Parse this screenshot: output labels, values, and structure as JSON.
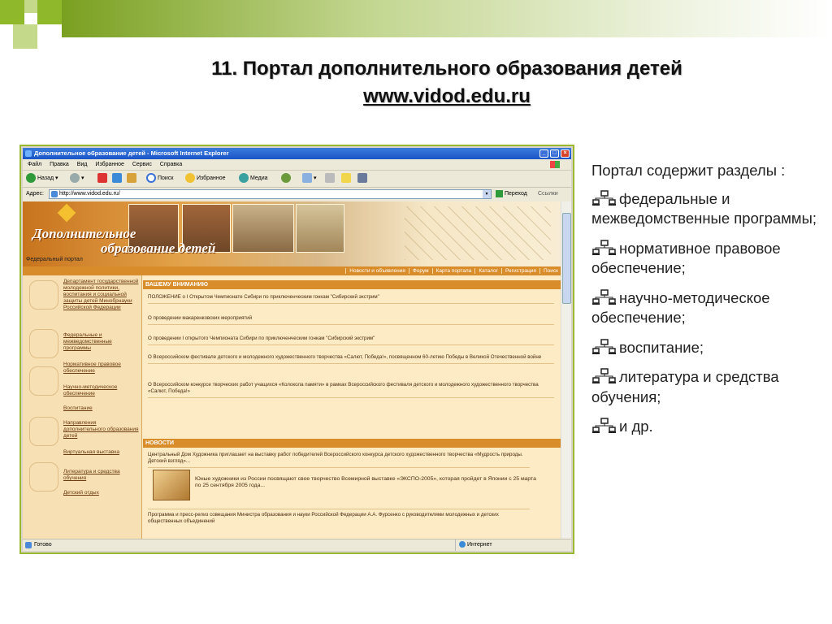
{
  "slide": {
    "title_line1": "11. Портал дополнительного образования детей",
    "title_line2": "www.vidod.edu.ru"
  },
  "browser": {
    "title": "Дополнительное образование детей - Microsoft Internet Explorer",
    "menu": [
      "Файл",
      "Правка",
      "Вид",
      "Избранное",
      "Сервис",
      "Справка"
    ],
    "toolbar": {
      "back": "Назад",
      "search": "Поиск",
      "favorites": "Избранное",
      "media": "Медиа"
    },
    "address_label": "Адрес:",
    "address": "http://www.vidod.edu.ru/",
    "go_label": "Переход",
    "links_label": "Ссылки",
    "status_left": "Готово",
    "status_right": "Интернет"
  },
  "site": {
    "banner_title_line1": "Дополнительное",
    "banner_title_line2": "образование детей",
    "federal_portal": "Федеральный портал",
    "nav_links": [
      "Новости и объявления",
      "Форум",
      "Карта портала",
      "Каталог",
      "Регистрация",
      "Поиск"
    ],
    "left_menu": [
      "Департамент государственной молодежной политики, воспитания и социальной защиты детей Минобрнауки Российской Федерации",
      "Федеральные и межведомственные программы",
      "Нормативное правовое обеспечение",
      "Научно-методическое обеспечение",
      "Воспитание",
      "Направления дополнительного образования детей",
      "Виртуальная выставка",
      "Литература и средства обучения",
      "Детский отдых"
    ],
    "attention_header": "ВАШЕМУ ВНИМАНИЮ",
    "attention_items": [
      "ПОЛОЖЕНИЕ о I Открытом Чемпионате Сибири по приключенческим гонкам \"Сибирский экстрим\"",
      "О проведении макаренковских мероприятий",
      "О проведении I открытого Чемпионата Сибири по приключенческим гонкам \"Сибирский экстрим\"",
      "О Всероссийском фестивале детского и молодежного художественного творчества «Салют, Победа!», посвященном 60-летию Победы в Великой Отечественной войне",
      "О Всероссийском конкурсе творческих работ учащихся «Колокола памяти» в рамках Всероссийского фестиваля детского и молодежного художественного творчества «Салют, Победа!»"
    ],
    "news_header": "НОВОСТИ",
    "news_items": [
      "Центральный Дом Художника приглашает на выставку работ победителей Всероссийского конкурса детского художественного творчества «Мудрость природы. Детский взгляд»...",
      "Юные художники из России посвящают свое творчество Всемирной выставке «ЭКСПО-2005», которая пройдет в Японии с 25 марта по 25 сентября 2005 года...",
      "Программа и пресс-релиз совещания Министра образования и науки Российской Федерации А.А. Фурсенко с руководителями молодежных и детских общественных объединений"
    ]
  },
  "right_panel": {
    "intro": "Портал содержит разделы :",
    "bullets": [
      "федеральные и межведомственные программы;",
      "нормативное правовое обеспечение;",
      "научно-методическое обеспечение;",
      "воспитание;",
      "литература и средства обучения;",
      "и др."
    ]
  },
  "colors": {
    "accent_green": "#9ab830",
    "site_orange": "#d98c2a",
    "site_bg": "#fcebc4"
  }
}
